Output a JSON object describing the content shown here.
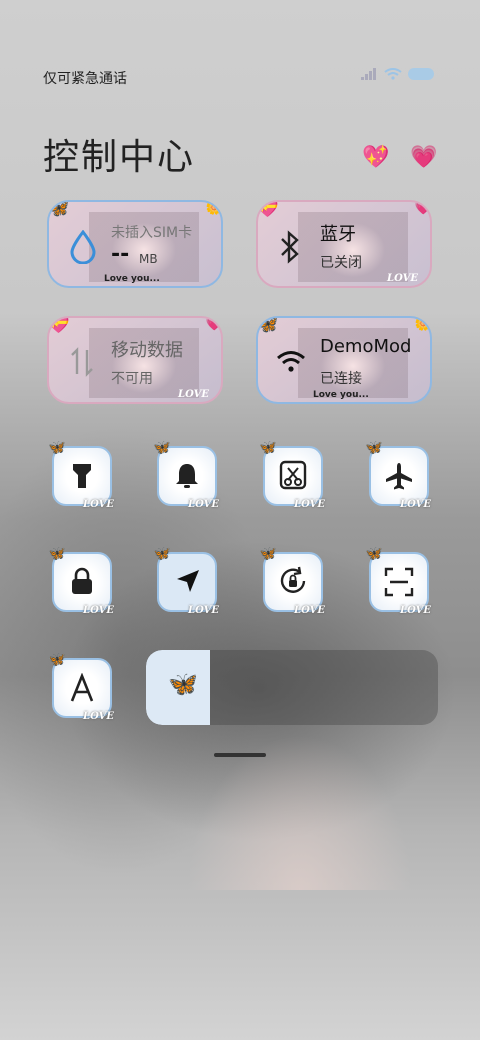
{
  "status": {
    "carrier": "仅可紧急通话",
    "battery_color": "#a9cbe6"
  },
  "title": "控制中心",
  "header_icons": [
    "sparkling-heart-icon",
    "growing-heart-icon"
  ],
  "tiles": {
    "data": {
      "title": "未插入SIM卡",
      "value": "--",
      "unit": "MB",
      "footer": "Love you..."
    },
    "bluetooth": {
      "title": "蓝牙",
      "status": "已关闭"
    },
    "mobile": {
      "title": "移动数据",
      "status": "不可用"
    },
    "wifi": {
      "title": "DemoMod",
      "status": "已连接",
      "footer": "Love you..."
    }
  },
  "love_label": "LOVE",
  "toggles_row1": [
    "flashlight-icon",
    "bell-icon",
    "screenshot-icon",
    "airplane-icon"
  ],
  "toggles_row2": [
    "lock-icon",
    "location-icon",
    "rotation-lock-icon",
    "scan-icon"
  ],
  "brightness": {
    "level": 0.22,
    "accent": "#3b8fd9"
  }
}
